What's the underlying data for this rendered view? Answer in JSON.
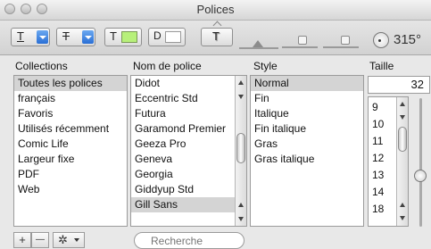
{
  "window": {
    "title": "Polices"
  },
  "toolbar": {
    "underline_glyph": "T",
    "strike_glyph": "T",
    "text_color_glyph": "T",
    "text_color_swatch": "#b7f07a",
    "doc_glyph": "D",
    "shadow_glyph": "T",
    "rotation_value": "315°"
  },
  "columns": {
    "collections": "Collections",
    "font_name": "Nom de police",
    "style": "Style",
    "size": "Taille"
  },
  "collections": [
    "Toutes les polices",
    "français",
    "Favoris",
    "Utilisés récemment",
    "Comic Life",
    "Largeur fixe",
    "PDF",
    "Web"
  ],
  "fonts": [
    "Didot",
    "Eccentric Std",
    "Futura",
    "Garamond Premier",
    "Geeza Pro",
    "Geneva",
    "Georgia",
    "Giddyup Std",
    "Gill Sans"
  ],
  "styles": [
    "Normal",
    "Fin",
    "Italique",
    "Fin italique",
    "Gras",
    "Gras italique"
  ],
  "size": {
    "value": "32",
    "list": [
      "9",
      "10",
      "11",
      "12",
      "13",
      "14",
      "18"
    ]
  },
  "bottom": {
    "add_label": "+",
    "remove_label": "—",
    "search_placeholder": "Recherche"
  }
}
